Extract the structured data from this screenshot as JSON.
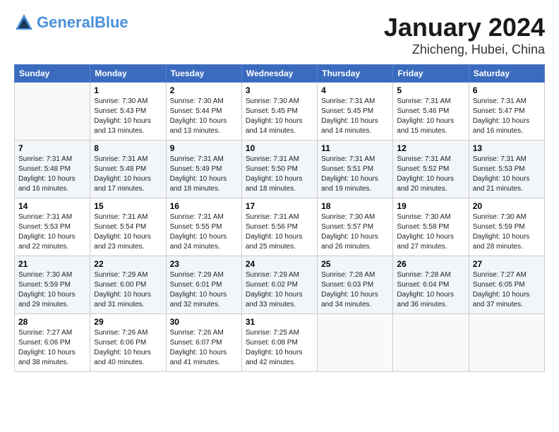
{
  "header": {
    "logo_line1": "General",
    "logo_line2": "Blue",
    "main_title": "January 2024",
    "sub_title": "Zhicheng, Hubei, China"
  },
  "days_of_week": [
    "Sunday",
    "Monday",
    "Tuesday",
    "Wednesday",
    "Thursday",
    "Friday",
    "Saturday"
  ],
  "weeks": [
    [
      {
        "day": "",
        "info": ""
      },
      {
        "day": "1",
        "info": "Sunrise: 7:30 AM\nSunset: 5:43 PM\nDaylight: 10 hours\nand 13 minutes."
      },
      {
        "day": "2",
        "info": "Sunrise: 7:30 AM\nSunset: 5:44 PM\nDaylight: 10 hours\nand 13 minutes."
      },
      {
        "day": "3",
        "info": "Sunrise: 7:30 AM\nSunset: 5:45 PM\nDaylight: 10 hours\nand 14 minutes."
      },
      {
        "day": "4",
        "info": "Sunrise: 7:31 AM\nSunset: 5:45 PM\nDaylight: 10 hours\nand 14 minutes."
      },
      {
        "day": "5",
        "info": "Sunrise: 7:31 AM\nSunset: 5:46 PM\nDaylight: 10 hours\nand 15 minutes."
      },
      {
        "day": "6",
        "info": "Sunrise: 7:31 AM\nSunset: 5:47 PM\nDaylight: 10 hours\nand 16 minutes."
      }
    ],
    [
      {
        "day": "7",
        "info": "Sunrise: 7:31 AM\nSunset: 5:48 PM\nDaylight: 10 hours\nand 16 minutes."
      },
      {
        "day": "8",
        "info": "Sunrise: 7:31 AM\nSunset: 5:48 PM\nDaylight: 10 hours\nand 17 minutes."
      },
      {
        "day": "9",
        "info": "Sunrise: 7:31 AM\nSunset: 5:49 PM\nDaylight: 10 hours\nand 18 minutes."
      },
      {
        "day": "10",
        "info": "Sunrise: 7:31 AM\nSunset: 5:50 PM\nDaylight: 10 hours\nand 18 minutes."
      },
      {
        "day": "11",
        "info": "Sunrise: 7:31 AM\nSunset: 5:51 PM\nDaylight: 10 hours\nand 19 minutes."
      },
      {
        "day": "12",
        "info": "Sunrise: 7:31 AM\nSunset: 5:52 PM\nDaylight: 10 hours\nand 20 minutes."
      },
      {
        "day": "13",
        "info": "Sunrise: 7:31 AM\nSunset: 5:53 PM\nDaylight: 10 hours\nand 21 minutes."
      }
    ],
    [
      {
        "day": "14",
        "info": "Sunrise: 7:31 AM\nSunset: 5:53 PM\nDaylight: 10 hours\nand 22 minutes."
      },
      {
        "day": "15",
        "info": "Sunrise: 7:31 AM\nSunset: 5:54 PM\nDaylight: 10 hours\nand 23 minutes."
      },
      {
        "day": "16",
        "info": "Sunrise: 7:31 AM\nSunset: 5:55 PM\nDaylight: 10 hours\nand 24 minutes."
      },
      {
        "day": "17",
        "info": "Sunrise: 7:31 AM\nSunset: 5:56 PM\nDaylight: 10 hours\nand 25 minutes."
      },
      {
        "day": "18",
        "info": "Sunrise: 7:30 AM\nSunset: 5:57 PM\nDaylight: 10 hours\nand 26 minutes."
      },
      {
        "day": "19",
        "info": "Sunrise: 7:30 AM\nSunset: 5:58 PM\nDaylight: 10 hours\nand 27 minutes."
      },
      {
        "day": "20",
        "info": "Sunrise: 7:30 AM\nSunset: 5:59 PM\nDaylight: 10 hours\nand 28 minutes."
      }
    ],
    [
      {
        "day": "21",
        "info": "Sunrise: 7:30 AM\nSunset: 5:59 PM\nDaylight: 10 hours\nand 29 minutes."
      },
      {
        "day": "22",
        "info": "Sunrise: 7:29 AM\nSunset: 6:00 PM\nDaylight: 10 hours\nand 31 minutes."
      },
      {
        "day": "23",
        "info": "Sunrise: 7:29 AM\nSunset: 6:01 PM\nDaylight: 10 hours\nand 32 minutes."
      },
      {
        "day": "24",
        "info": "Sunrise: 7:29 AM\nSunset: 6:02 PM\nDaylight: 10 hours\nand 33 minutes."
      },
      {
        "day": "25",
        "info": "Sunrise: 7:28 AM\nSunset: 6:03 PM\nDaylight: 10 hours\nand 34 minutes."
      },
      {
        "day": "26",
        "info": "Sunrise: 7:28 AM\nSunset: 6:04 PM\nDaylight: 10 hours\nand 36 minutes."
      },
      {
        "day": "27",
        "info": "Sunrise: 7:27 AM\nSunset: 6:05 PM\nDaylight: 10 hours\nand 37 minutes."
      }
    ],
    [
      {
        "day": "28",
        "info": "Sunrise: 7:27 AM\nSunset: 6:06 PM\nDaylight: 10 hours\nand 38 minutes."
      },
      {
        "day": "29",
        "info": "Sunrise: 7:26 AM\nSunset: 6:06 PM\nDaylight: 10 hours\nand 40 minutes."
      },
      {
        "day": "30",
        "info": "Sunrise: 7:26 AM\nSunset: 6:07 PM\nDaylight: 10 hours\nand 41 minutes."
      },
      {
        "day": "31",
        "info": "Sunrise: 7:25 AM\nSunset: 6:08 PM\nDaylight: 10 hours\nand 42 minutes."
      },
      {
        "day": "",
        "info": ""
      },
      {
        "day": "",
        "info": ""
      },
      {
        "day": "",
        "info": ""
      }
    ]
  ]
}
